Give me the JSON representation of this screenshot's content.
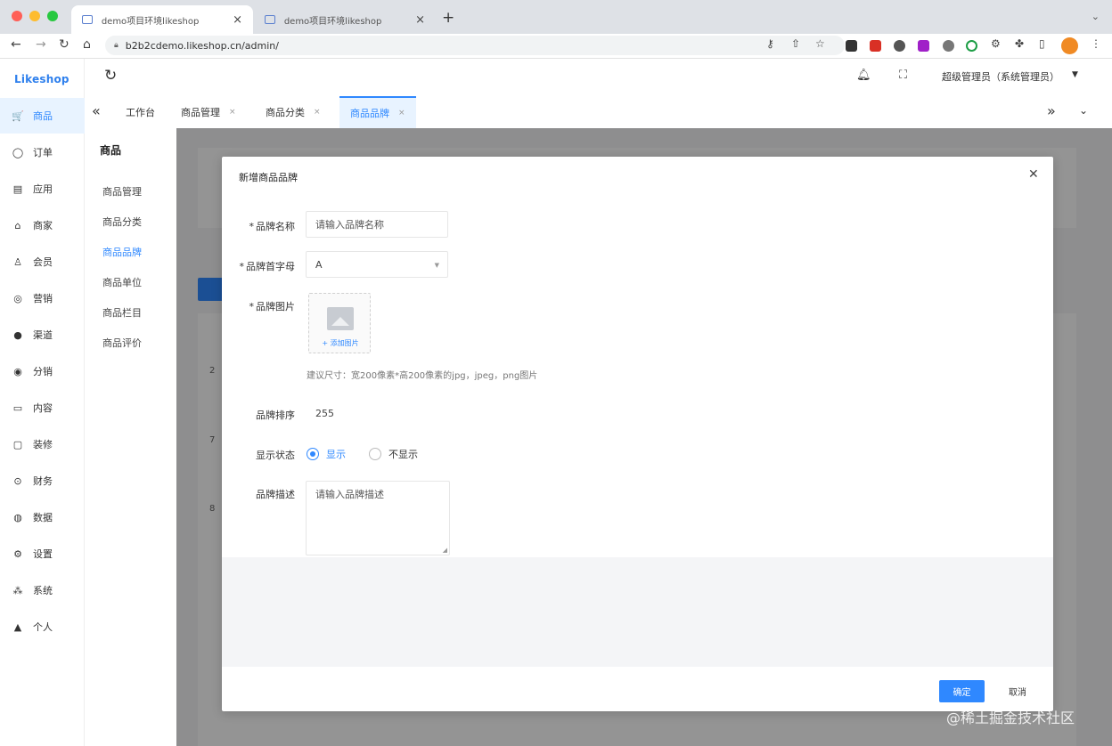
{
  "browser": {
    "tabs": [
      {
        "label": "demo项目环境likeshop"
      },
      {
        "label": "demo项目环境likeshop"
      }
    ],
    "new_tab": "+",
    "url": "b2b2cdemo.likeshop.cn/admin/"
  },
  "app": {
    "logo": "Likeshop",
    "sidebar": [
      {
        "icon": "🛒",
        "label": "商品"
      },
      {
        "icon": "◯",
        "label": "订单"
      },
      {
        "icon": "▤",
        "label": "应用"
      },
      {
        "icon": "⌂",
        "label": "商家"
      },
      {
        "icon": "♙",
        "label": "会员"
      },
      {
        "icon": "◎",
        "label": "营销"
      },
      {
        "icon": "●",
        "label": "渠道"
      },
      {
        "icon": "◉",
        "label": "分销"
      },
      {
        "icon": "▭",
        "label": "内容"
      },
      {
        "icon": "▢",
        "label": "装修"
      },
      {
        "icon": "⊙",
        "label": "财务"
      },
      {
        "icon": "◍",
        "label": "数据"
      },
      {
        "icon": "⚙",
        "label": "设置"
      },
      {
        "icon": "⁂",
        "label": "系统"
      },
      {
        "icon": "▲",
        "label": "个人"
      }
    ],
    "topbar": {
      "user": "超级管理员（系统管理员）"
    },
    "tabs": [
      {
        "label": "工作台"
      },
      {
        "label": "商品管理"
      },
      {
        "label": "商品分类"
      },
      {
        "label": "商品品牌"
      }
    ],
    "submenu": {
      "title": "商品",
      "items": [
        "商品管理",
        "商品分类",
        "商品品牌",
        "商品单位",
        "商品栏目",
        "商品评价"
      ]
    }
  },
  "dialog": {
    "title": "新增商品品牌",
    "fields": {
      "name": {
        "label": "品牌名称",
        "placeholder": "请输入品牌名称"
      },
      "initial": {
        "label": "品牌首字母",
        "value": "A"
      },
      "image": {
        "label": "品牌图片",
        "upload_label": "+ 添加图片",
        "hint": "建议尺寸：宽200像素*高200像素的jpg，jpeg，png图片"
      },
      "sort": {
        "label": "品牌排序",
        "value": "255"
      },
      "status": {
        "label": "显示状态",
        "options": [
          "显示",
          "不显示"
        ],
        "selected": "显示"
      },
      "desc": {
        "label": "品牌描述",
        "placeholder": "请输入品牌描述"
      }
    },
    "confirm": "确定",
    "cancel": "取消"
  },
  "background_rows": [
    "2",
    "7",
    "8"
  ],
  "watermark": "@稀土掘金技术社区",
  "colors": {
    "primary": "#2f88ff",
    "overlay": "rgba(0,0,0,0.42)"
  }
}
